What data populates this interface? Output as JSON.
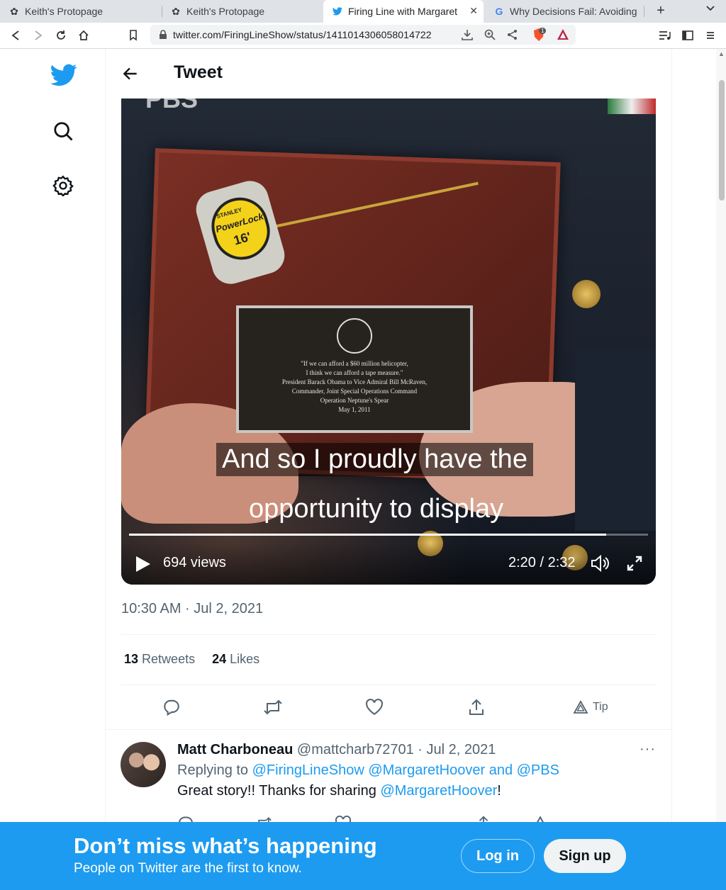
{
  "browser": {
    "tabs": [
      {
        "title": "Keith's Protopage",
        "icon": "protopage-icon"
      },
      {
        "title": "Keith's Protopage",
        "icon": "protopage-icon"
      },
      {
        "title": "Firing Line with Margaret",
        "icon": "twitter-icon",
        "active": true
      },
      {
        "title": "Why Decisions Fail: Avoiding",
        "icon": "google-icon"
      }
    ],
    "url": "twitter.com/FiringLineShow/status/1411014306058014722",
    "shield_badge": "1"
  },
  "header": {
    "title": "Tweet"
  },
  "video": {
    "caption_line1": "And so I proudly have the",
    "caption_line2": "opportunity to display",
    "views": "694 views",
    "time": "2:20 / 2:32",
    "progress": 0.92,
    "watermark": "PBS",
    "plaque_lines": [
      "\"If we can afford a $60 million helicopter,",
      "I think we can afford a tape measure.\"",
      "President Barack Obama to Vice Admiral Bill McRaven,",
      "Commander, Joint Special Operations Command",
      "Operation Neptune's Spear",
      "May 1, 2011"
    ],
    "tape_brand": "STANLEY",
    "tape_model": "PowerLock",
    "tape_size": "16'"
  },
  "tweet": {
    "timestamp": "10:30 AM · Jul 2, 2021",
    "retweets_count": "13",
    "retweets_label": "Retweets",
    "likes_count": "24",
    "likes_label": "Likes",
    "tip_label": "Tip"
  },
  "reply": {
    "name": "Matt Charboneau",
    "handle_date": "@mattcharb72701 · Jul 2, 2021",
    "replying_prefix": "Replying to",
    "replying_to": "@FiringLineShow @MargaretHoover and @PBS",
    "text_prefix": "Great story!! Thanks for sharing",
    "text_mention": "@MargaretHoover",
    "text_suffix": "!",
    "more": "···"
  },
  "banner": {
    "title": "Don’t miss what’s happening",
    "subtitle": "People on Twitter are the first to know.",
    "login": "Log in",
    "signup": "Sign up"
  },
  "colors": {
    "twitter_blue": "#1d9bf0",
    "text": "#0f1419",
    "muted": "#536471"
  }
}
